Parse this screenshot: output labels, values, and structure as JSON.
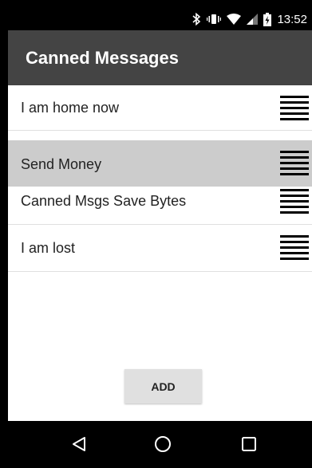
{
  "status_bar": {
    "time": "13:52",
    "icons": [
      "bluetooth-icon",
      "vibrate-icon",
      "wifi-icon",
      "signal-icon",
      "battery-charging-icon"
    ]
  },
  "app_bar": {
    "title": "Canned Messages"
  },
  "messages": [
    {
      "label": "I am home now"
    },
    {
      "label": "Send Money",
      "highlighted": true
    },
    {
      "label": "Canned Msgs Save Bytes"
    },
    {
      "label": "I am lost"
    }
  ],
  "add_button": {
    "label": "ADD"
  },
  "nav_bar": {
    "icons": [
      "back-icon",
      "home-icon",
      "recents-icon"
    ]
  },
  "colors": {
    "app_bar": "#444444",
    "highlight": "#cccccc",
    "button": "#e0e0e0"
  }
}
